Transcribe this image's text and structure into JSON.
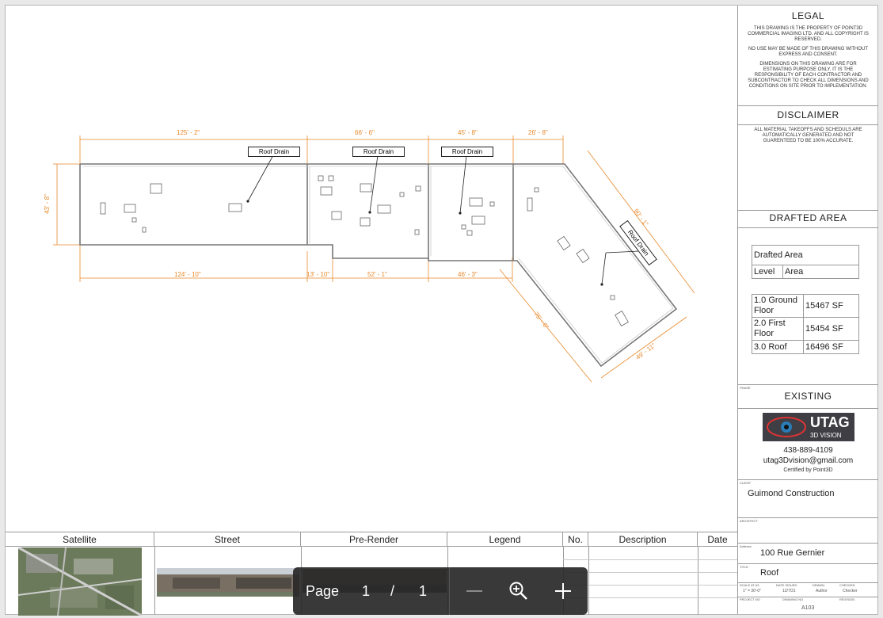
{
  "legal": {
    "heading": "LEGAL",
    "para1": "THIS DRAWING IS THE PROPERTY OF POINT3D COMMERCIAL IMAGING LTD. AND ALL COPYRIGHT IS RESERVED.",
    "para2": "NO USE MAY BE MADE OF THIS DRAWING WITHOUT EXPRESS AND CONSENT.",
    "para3": "DIMENSIONS ON THIS DRAWING ARE FOR ESTIMATING PURPOSE ONLY. IT IS THE RESPONSIBILITY OF EACH CONTRACTOR AND SUBCONTRACTOR TO CHECK ALL DIMENSIONS AND CONDITIONS ON SITE PRIOR TO IMPLEMENTATION."
  },
  "disclaimer": {
    "heading": "DISCLAIMER",
    "text": "ALL MATERIAL TAKEOFFS AND SCHEDULS ARE AUTOMATICALLY GENERATED AND NOT GUARENTEED TO BE 100% ACCURATE."
  },
  "drafted_area": {
    "heading": "DRAFTED AREA",
    "title": "Drafted Area",
    "col1": "Level",
    "col2": "Area",
    "rows": [
      {
        "level": "1.0 Ground Floor",
        "area": "15467 SF"
      },
      {
        "level": "2.0 First Floor",
        "area": "15454 SF"
      },
      {
        "level": "3.0 Roof",
        "area": "16496 SF"
      }
    ]
  },
  "phase": {
    "label": "PHASE",
    "value": "EXISTING"
  },
  "company": {
    "logo_text": "UTAG",
    "logo_sub": "3D VISION",
    "phone": "438-889-4109",
    "email": "utag3Dvision@gmail.com",
    "certified": "Certified by Point3D"
  },
  "client": {
    "label": "CLIENT",
    "value": "Guimond Construction"
  },
  "architect": {
    "label": "ARCHITECT"
  },
  "address": {
    "label": "Address",
    "value": "100 Rue Gernier"
  },
  "title": {
    "label": "TITLE",
    "value": "Roof"
  },
  "meta": {
    "scale_label": "SCALE AT A3",
    "scale": "1\" = 30'-0\"",
    "date_label": "DATE ISSUED",
    "date": "12/7/21",
    "drawn_label": "DRAWN",
    "drawn": "Author",
    "checked_label": "CHECKED",
    "checked": "Checker",
    "project_label": "PROJECT NO",
    "drawing_label": "DRAWING NO",
    "drawing": "A103",
    "revision_label": "REVISION"
  },
  "bottom": {
    "satellite": "Satellite",
    "street": "Street",
    "prerender": "Pre-Render",
    "legend": "Legend",
    "no": "No.",
    "description": "Description",
    "date": "Date"
  },
  "plan": {
    "dims": [
      "125' - 2\"",
      "66' - 6\"",
      "45' - 8\"",
      "26' - 8\"",
      "43' - 8\"",
      "124' - 10\"",
      "13' - 10\"",
      "52' - 1\"",
      "46' - 3\"",
      "90' - 1\"",
      "75' - 6\"",
      "49' - 11\""
    ],
    "drains": [
      "Roof Drain",
      "Roof Drain",
      "Roof Drain",
      "Roof Drain"
    ],
    "dim_color": "#e8892a"
  },
  "toolbar": {
    "page_label": "Page",
    "current": "1",
    "slash": "/",
    "total": "1"
  }
}
